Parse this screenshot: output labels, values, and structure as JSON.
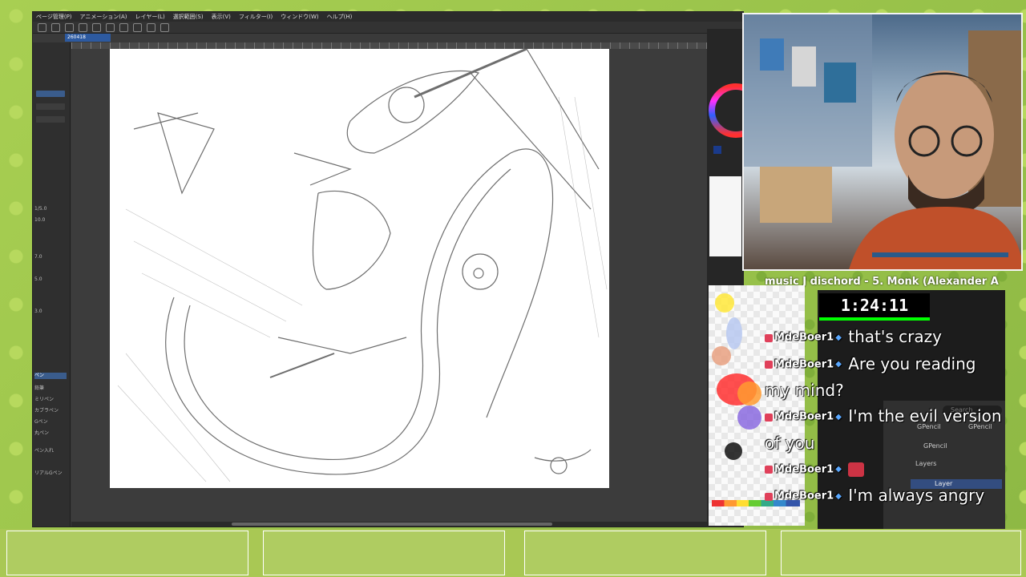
{
  "app": {
    "menu": [
      "ページ管理(P)",
      "アニメーション(A)",
      "レイヤー(L)",
      "選択範囲(S)",
      "表示(V)",
      "フィルター(I)",
      "ウィンドウ(W)",
      "ヘルプ(H)"
    ],
    "doc_tab": "260418",
    "tool_labels": [
      "1/5.0",
      "10.0",
      "7.0",
      "5.0",
      "3.0",
      "ペン",
      "鉛筆",
      "ミリペン",
      "カブラペン",
      "Gペン",
      "丸ペン",
      "ペン入れ",
      "リアルGペン"
    ]
  },
  "music": "music J dischord - 5. Monk (Alexander A",
  "timer": "1:24:11",
  "chat": [
    {
      "user": "MdeBoer1",
      "text": "that's crazy"
    },
    {
      "user": "MdeBoer1",
      "text": "Are you reading my mind?"
    },
    {
      "user": "MdeBoer1",
      "text": "I'm the evil version of you"
    },
    {
      "user": "MdeBoer1",
      "text": ""
    },
    {
      "user": "MdeBoer1",
      "text": "I'm always angry"
    }
  ],
  "blender": {
    "search": "Search",
    "breadcrumb1": "GPencil",
    "breadcrumb2": "GPencil",
    "object": "GPencil",
    "layers_header": "Layers",
    "layer": "Layer"
  },
  "colors": {
    "accent_blue": "#2d5aa0",
    "timer_green": "#00ff00",
    "badge_red": "#e0405a"
  }
}
